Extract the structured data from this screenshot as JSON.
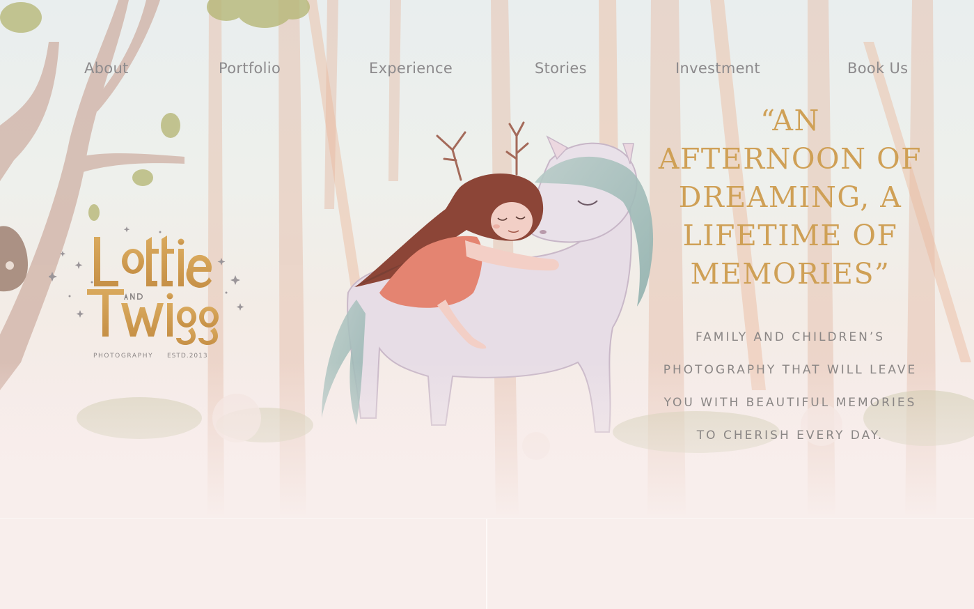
{
  "nav": {
    "items": [
      {
        "label": "About"
      },
      {
        "label": "Portfolio"
      },
      {
        "label": "Experience"
      },
      {
        "label": "Stories"
      },
      {
        "label": "Investment"
      },
      {
        "label": "Book Us"
      }
    ]
  },
  "logo": {
    "wordmark": "Lottie and Twigg",
    "subtitle_left": "PHOTOGRAPHY",
    "subtitle_right": "ESTD.2013"
  },
  "hero": {
    "quote": "“AN AFTERNOON OF DREAMING, A LIFETIME OF MEMORIES”",
    "tagline": "FAMILY AND CHILDREN’S PHOTOGRAPHY THAT WILL LEAVE YOU WITH BEAUTIFUL MEMORIES TO CHERISH EVERY DAY.",
    "illustration": "girl-hugging-unicorn"
  },
  "colors": {
    "gold": "#cfa056",
    "nav_text": "#8c8a8c",
    "tagline_text": "#8a8685",
    "background": "#f8eeec"
  }
}
